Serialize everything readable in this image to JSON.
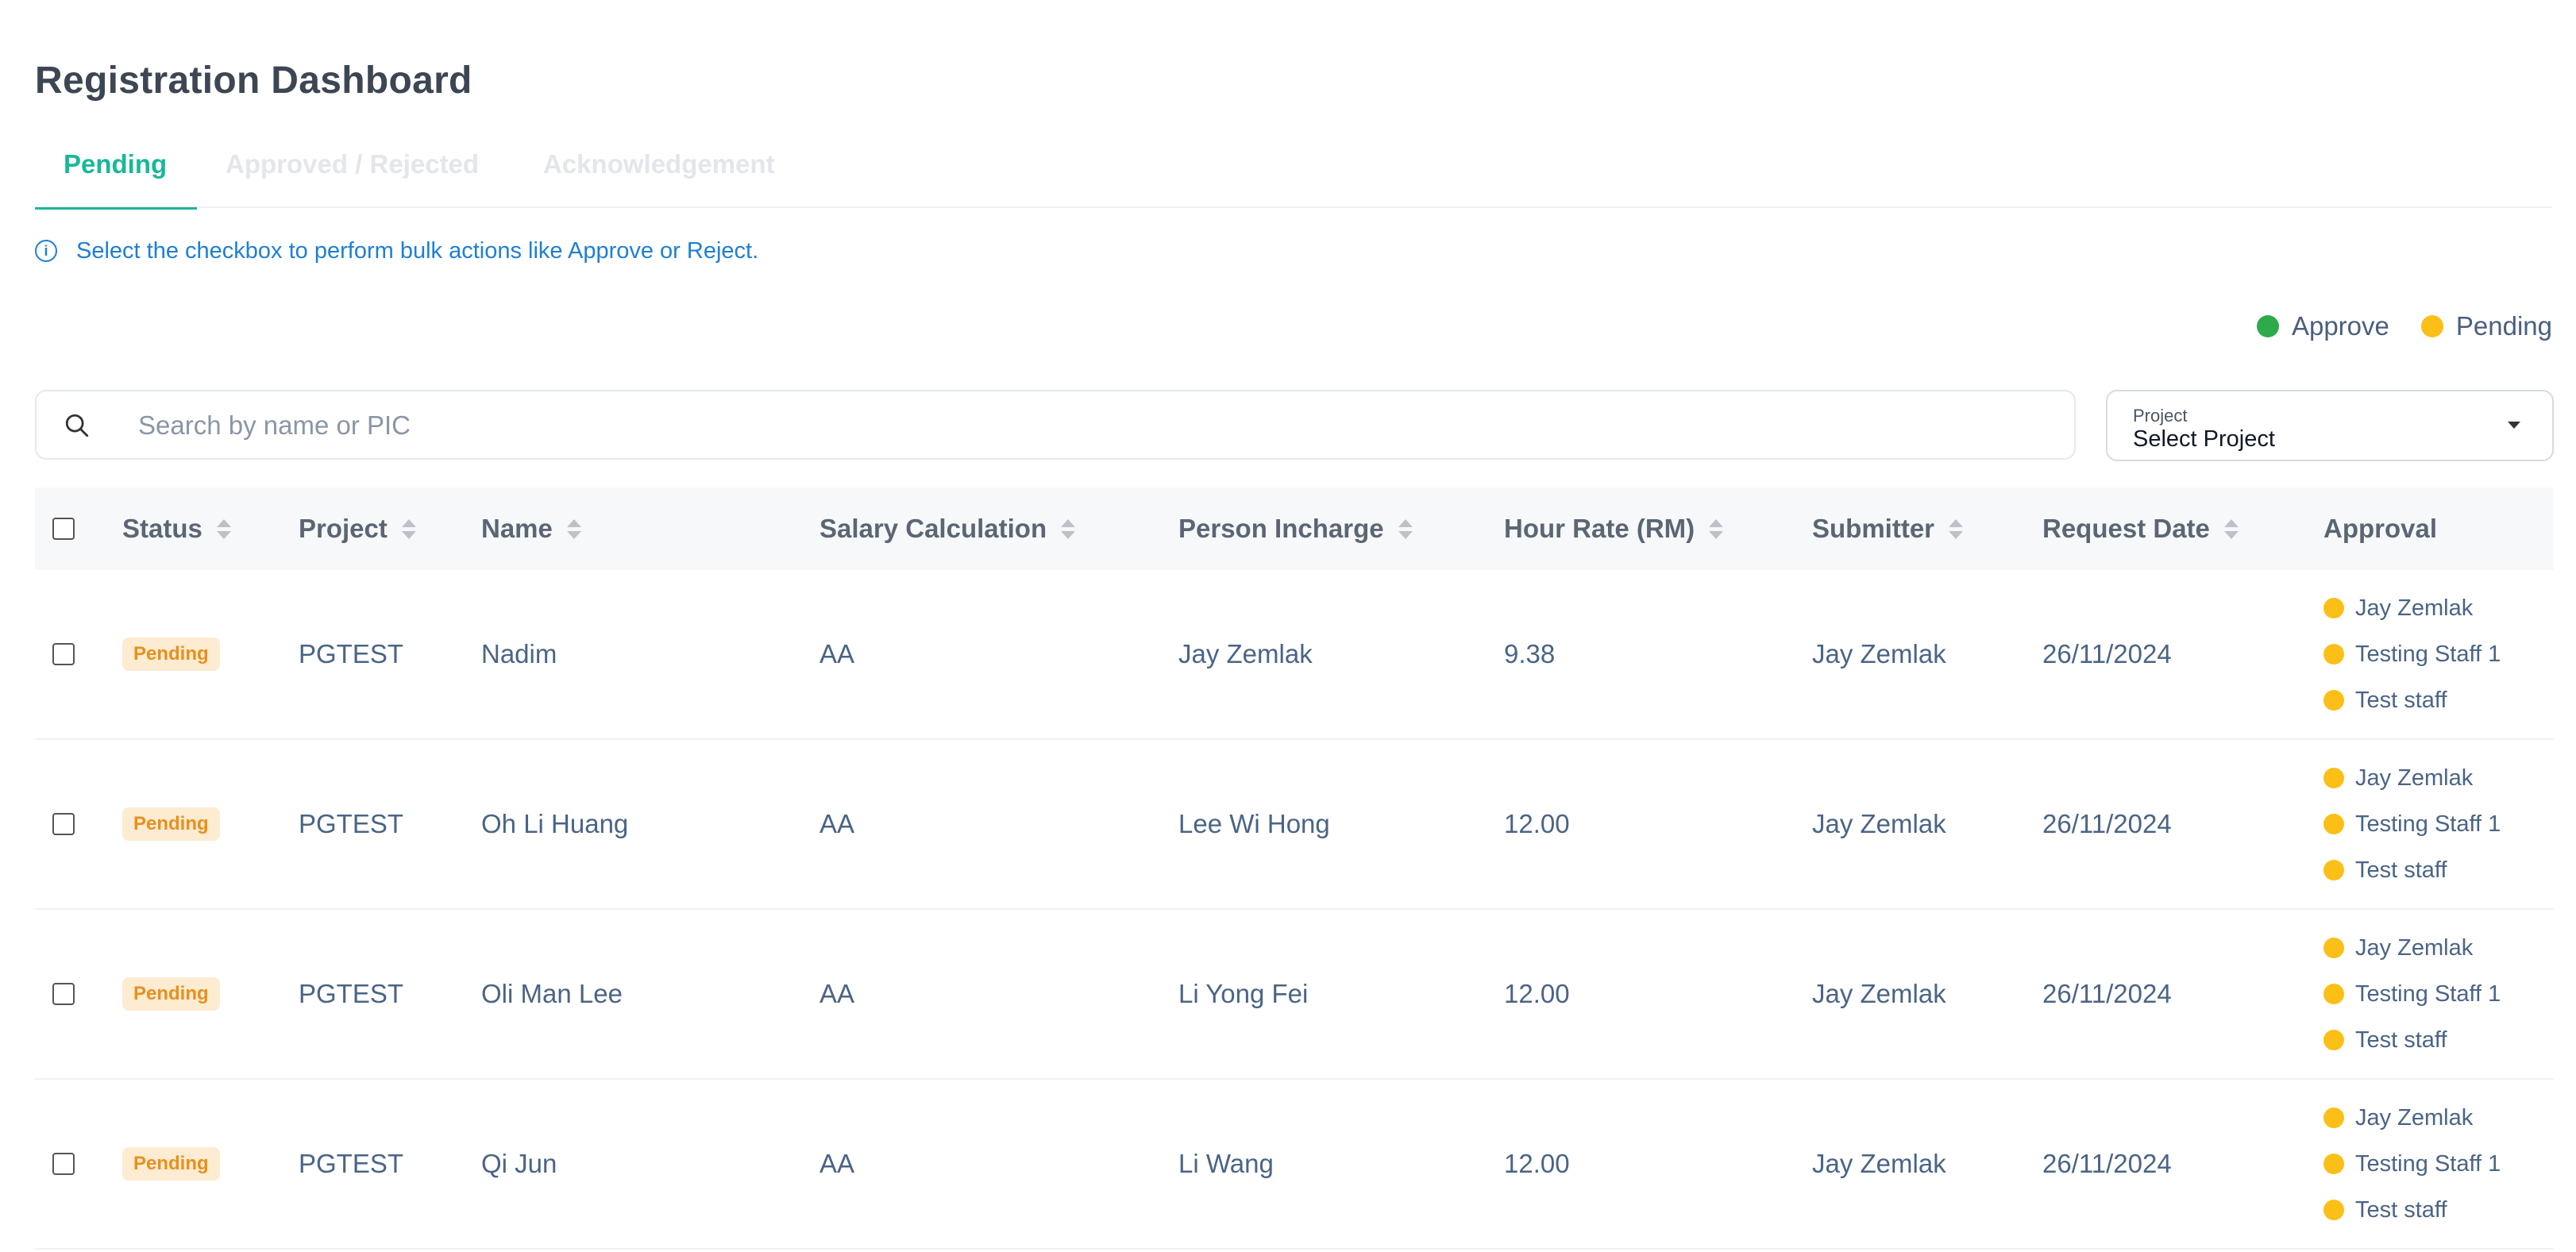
{
  "page": {
    "title": "Registration Dashboard"
  },
  "tabs": [
    {
      "label": "Pending",
      "active": true
    },
    {
      "label": "Approved / Rejected",
      "active": false
    },
    {
      "label": "Acknowledgement",
      "active": false
    }
  ],
  "info": {
    "icon": "info-icon",
    "text": "Select the checkbox to perform bulk actions like Approve or Reject."
  },
  "legend": [
    {
      "label": "Approve",
      "color": "#2eaa4a"
    },
    {
      "label": "Pending",
      "color": "#fbbf17"
    }
  ],
  "search": {
    "placeholder": "Search by name or PIC",
    "value": "",
    "icon": "search-icon"
  },
  "project_filter": {
    "label": "Project",
    "value": "Select Project"
  },
  "table": {
    "columns": [
      "Status",
      "Project",
      "Name",
      "Salary Calculation",
      "Person Incharge",
      "Hour Rate (RM)",
      "Submitter",
      "Request Date",
      "Approval"
    ],
    "rows": [
      {
        "status": "Pending",
        "project": "PGTEST",
        "name": "Nadim",
        "salary": "AA",
        "pic": "Jay Zemlak",
        "rate": "9.38",
        "submitter": "Jay Zemlak",
        "date": "26/11/2024",
        "approvers": [
          {
            "name": "Jay Zemlak",
            "color": "#fbbf17"
          },
          {
            "name": "Testing Staff 1",
            "color": "#fbbf17"
          },
          {
            "name": "Test staff",
            "color": "#fbbf17"
          }
        ]
      },
      {
        "status": "Pending",
        "project": "PGTEST",
        "name": "Oh Li Huang",
        "salary": "AA",
        "pic": "Lee Wi Hong",
        "rate": "12.00",
        "submitter": "Jay Zemlak",
        "date": "26/11/2024",
        "approvers": [
          {
            "name": "Jay Zemlak",
            "color": "#fbbf17"
          },
          {
            "name": "Testing Staff 1",
            "color": "#fbbf17"
          },
          {
            "name": "Test staff",
            "color": "#fbbf17"
          }
        ]
      },
      {
        "status": "Pending",
        "project": "PGTEST",
        "name": "Oli Man Lee",
        "salary": "AA",
        "pic": "Li Yong Fei",
        "rate": "12.00",
        "submitter": "Jay Zemlak",
        "date": "26/11/2024",
        "approvers": [
          {
            "name": "Jay Zemlak",
            "color": "#fbbf17"
          },
          {
            "name": "Testing Staff 1",
            "color": "#fbbf17"
          },
          {
            "name": "Test staff",
            "color": "#fbbf17"
          }
        ]
      },
      {
        "status": "Pending",
        "project": "PGTEST",
        "name": "Qi Jun",
        "salary": "AA",
        "pic": "Li Wang",
        "rate": "12.00",
        "submitter": "Jay Zemlak",
        "date": "26/11/2024",
        "approvers": [
          {
            "name": "Jay Zemlak",
            "color": "#fbbf17"
          },
          {
            "name": "Testing Staff 1",
            "color": "#fbbf17"
          },
          {
            "name": "Test staff",
            "color": "#fbbf17"
          }
        ]
      }
    ]
  }
}
